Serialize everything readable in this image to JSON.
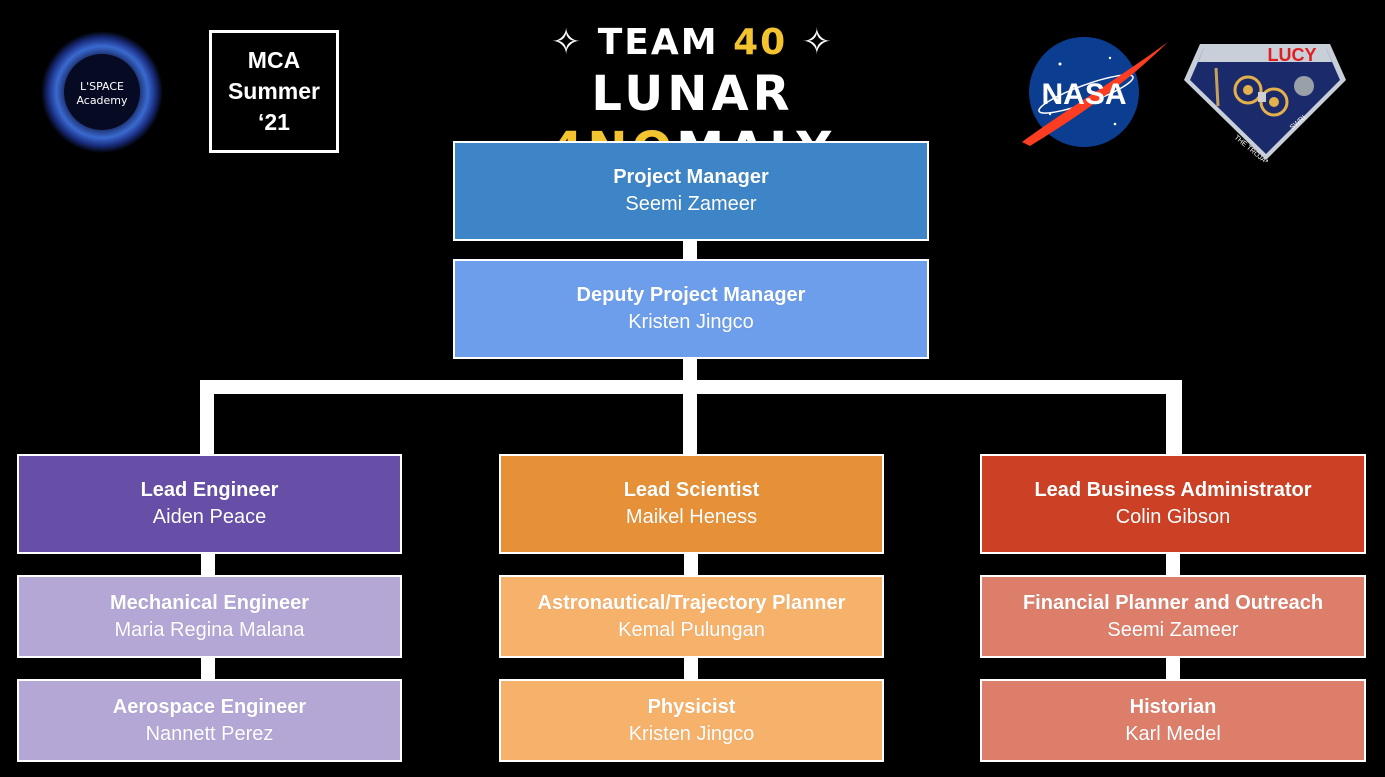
{
  "header": {
    "star_glyph": "✧",
    "title_prefix": "TEAM ",
    "title_number": "40",
    "subtitle_a": "LUNAR ",
    "subtitle_b": "4NO",
    "subtitle_c": "MALY"
  },
  "logos": {
    "space_academy": {
      "line1": "L'SPACE",
      "line2": "Academy"
    },
    "mca": {
      "line1": "MCA",
      "line2": "Summer",
      "line3": "‘21"
    },
    "nasa": {
      "text": "NASA"
    },
    "lucy": {
      "text": "LUCY",
      "ribbon_left": "THE TROJANS",
      "ribbon_right": "SWRI"
    }
  },
  "org": {
    "top": [
      {
        "role": "Project Manager",
        "name": "Seemi Zameer",
        "color": "#3d85c6"
      },
      {
        "role": "Deputy Project Manager",
        "name": "Kristen Jingco",
        "color": "#6d9eeb"
      }
    ],
    "columns": [
      {
        "lead": {
          "role": "Lead Engineer",
          "name": "Aiden Peace",
          "color": "#674ea7"
        },
        "members": [
          {
            "role": "Mechanical Engineer",
            "name": "Maria Regina Malana",
            "color": "#b4a7d6"
          },
          {
            "role": "Aerospace Engineer",
            "name": "Nannett Perez",
            "color": "#b4a7d6"
          }
        ]
      },
      {
        "lead": {
          "role": "Lead Scientist",
          "name": "Maikel Heness",
          "color": "#e69138"
        },
        "members": [
          {
            "role": "Astronautical/Trajectory Planner",
            "name": "Kemal Pulungan",
            "color": "#f6b26b"
          },
          {
            "role": "Physicist",
            "name": "Kristen Jingco",
            "color": "#f6b26b"
          }
        ]
      },
      {
        "lead": {
          "role": "Lead Business Administrator",
          "name": "Colin Gibson",
          "color": "#cc4125"
        },
        "members": [
          {
            "role": "Financial Planner and Outreach",
            "name": "Seemi Zameer",
            "color": "#dd7e6b"
          },
          {
            "role": "Historian",
            "name": "Karl Medel",
            "color": "#dd7e6b"
          }
        ]
      }
    ]
  }
}
